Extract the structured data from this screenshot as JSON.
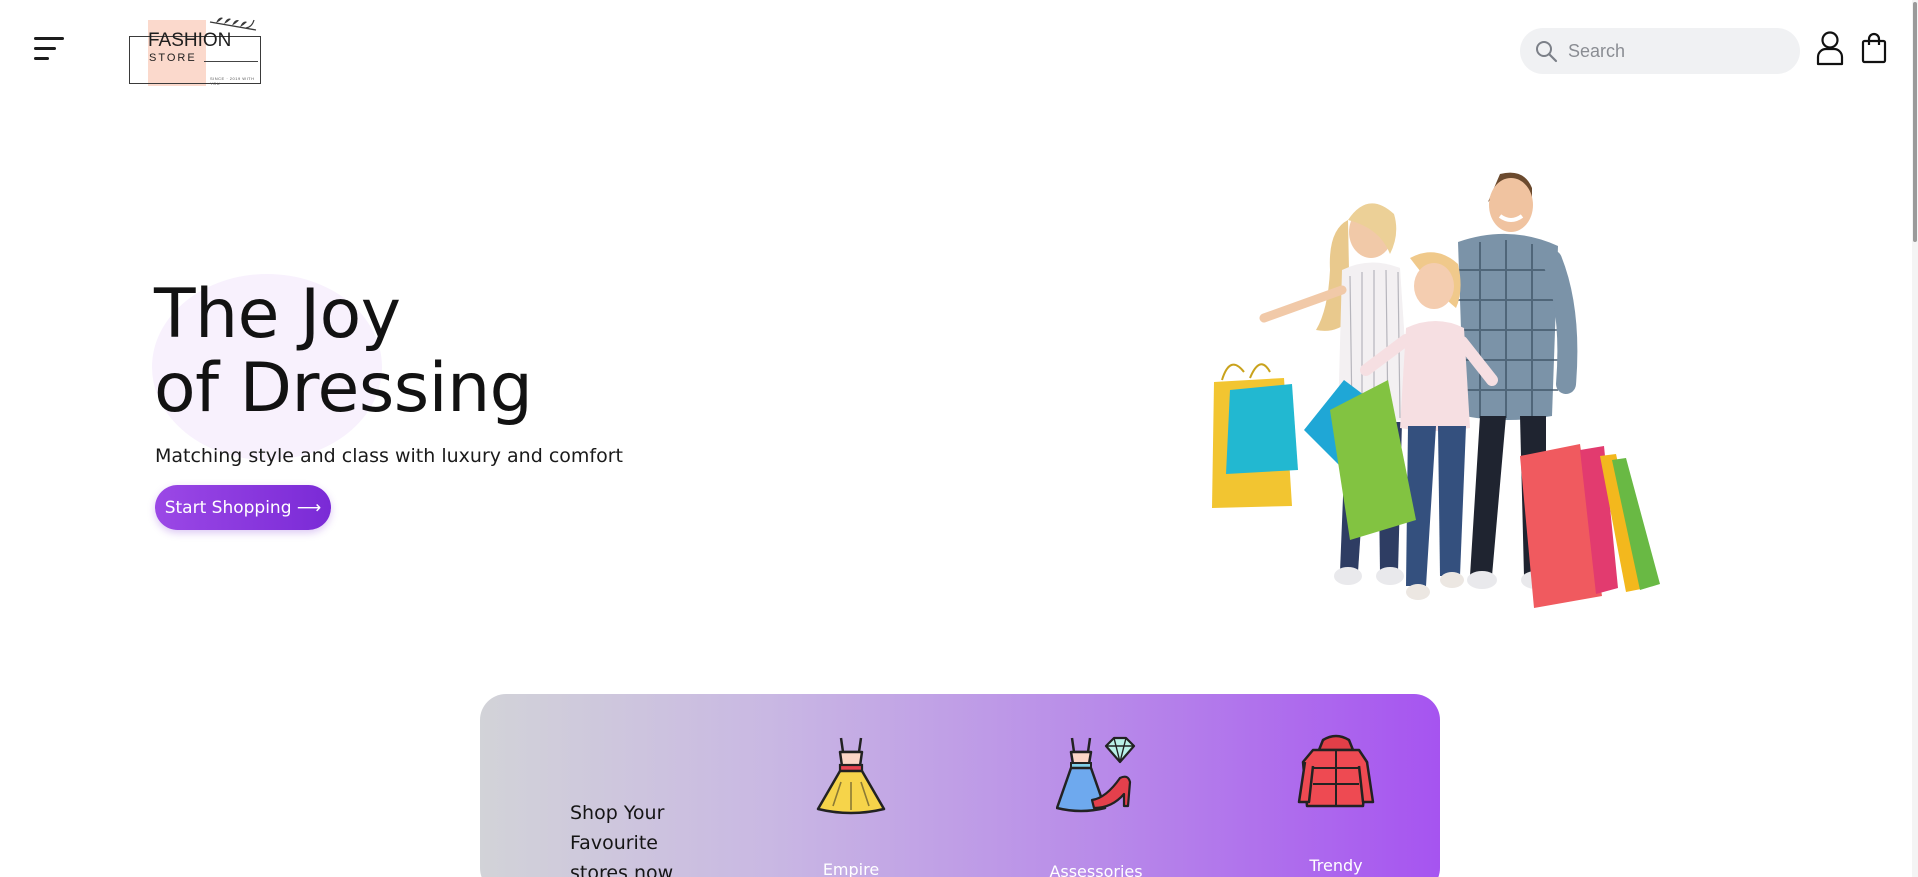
{
  "header": {
    "menu_icon": "hamburger-menu-icon",
    "logo": {
      "brand": "FASHION",
      "sub": "STORE",
      "since": "SINCE · 2019 WITH YOU"
    },
    "search": {
      "placeholder": "Search",
      "icon": "search-icon"
    },
    "account_icon": "user-icon",
    "cart_icon": "shopping-bag-icon"
  },
  "hero": {
    "title_line1": "The Joy",
    "title_line2": "of Dressing",
    "subtitle": "Matching style and class with luxury and comfort",
    "cta_label": "Start Shopping ⟶",
    "image": "family-with-shopping-bags"
  },
  "categories": {
    "heading_line1": "Shop Your",
    "heading_line2": "Favourite",
    "heading_line3": "stores now",
    "items": [
      {
        "label": "Empire",
        "icon": "dress-icon"
      },
      {
        "label": "Assessories",
        "icon": "dress-heels-gem-icon"
      },
      {
        "label": "Trendy",
        "icon": "jacket-icon"
      }
    ]
  },
  "colors": {
    "accent": "#8b3ae0",
    "panel_start": "#d2d3d8",
    "panel_end": "#a654f0",
    "search_bg": "#f0f1f3"
  }
}
